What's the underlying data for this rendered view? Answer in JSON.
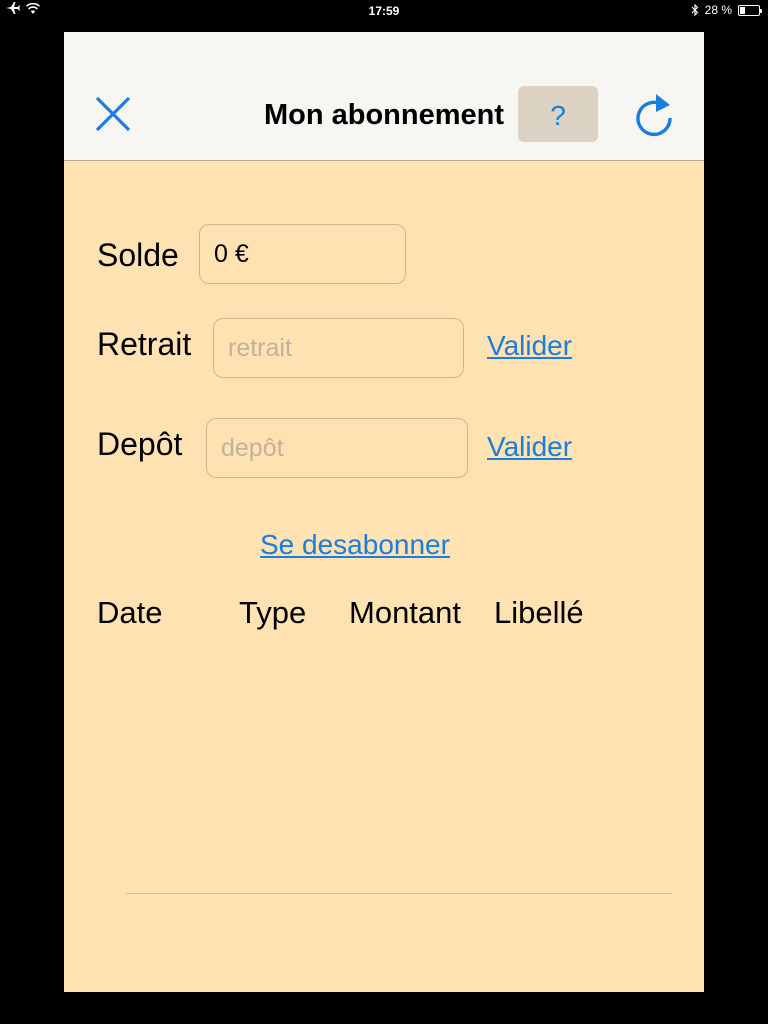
{
  "status_bar": {
    "time": "17:59",
    "battery_text": "28 %",
    "battery_level": 0.28
  },
  "nav": {
    "title": "Mon abonnement",
    "help_label": "?",
    "close_icon": "close-icon",
    "refresh_icon": "refresh-icon"
  },
  "form": {
    "solde_label": "Solde",
    "solde_value": "0 €",
    "retrait_label": "Retrait",
    "retrait_placeholder": "retrait",
    "retrait_validate": "Valider",
    "depot_label": "Depôt",
    "depot_placeholder": "depôt",
    "depot_validate": "Valider",
    "unsubscribe_label": "Se desabonner"
  },
  "table": {
    "columns": [
      "Date",
      "Type",
      "Montant",
      "Libellé"
    ],
    "rows": []
  },
  "colors": {
    "accent": "#1a7de0",
    "background": "#ffe2b1",
    "nav_background": "#f7f6f3"
  }
}
